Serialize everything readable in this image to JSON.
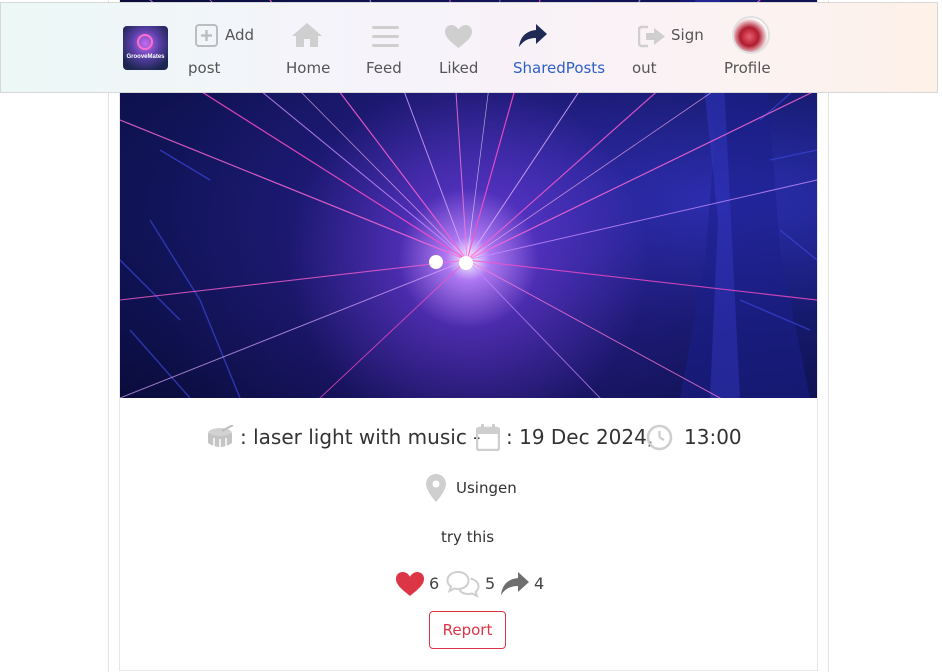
{
  "nav": {
    "logo_text": "GrooveMates",
    "items": [
      {
        "label": "Add",
        "label2": "post",
        "icon": "plus-square-icon"
      },
      {
        "label": "Home",
        "icon": "home-icon"
      },
      {
        "label": "Feed",
        "icon": "bars-icon"
      },
      {
        "label": "Liked",
        "icon": "heart-icon"
      },
      {
        "label": "SharedPosts",
        "icon": "share-icon",
        "active": true
      },
      {
        "label": "Sign",
        "label2": "out",
        "icon": "sign-out-icon"
      },
      {
        "label": "Profile",
        "icon": "avatar"
      }
    ],
    "active_color": "#2d5fc8"
  },
  "post": {
    "title": ": laser light with music -",
    "date": ": 19 Dec 2024,",
    "time": "13:00",
    "location": "Usingen",
    "description": "try this",
    "likes": "6",
    "comments": "5",
    "shares": "4",
    "report_label": "Report",
    "like_color": "#dc3545"
  }
}
